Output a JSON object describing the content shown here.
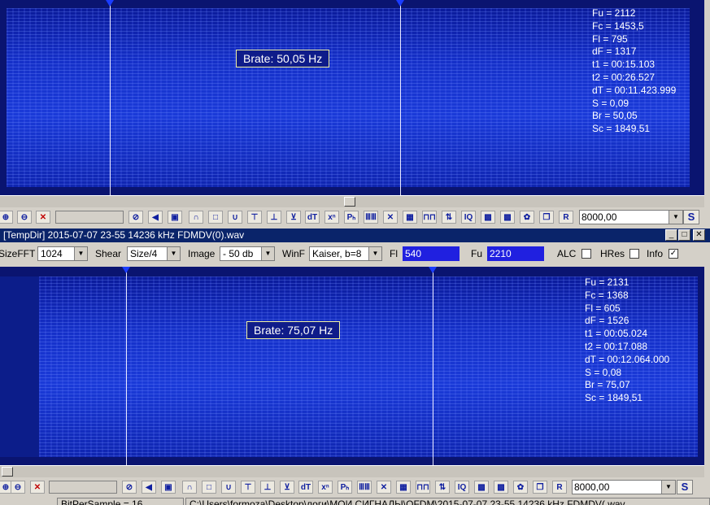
{
  "top_panel": {
    "brate_label": "Brate: 50,05 Hz",
    "info": [
      "Fu = 2112",
      "Fc = 1453,5",
      "Fl = 795",
      "dF = 1317",
      "t1 = 00:15.103",
      "t2 = 00:26.527",
      "dT = 00:11.423.999",
      "S = 0,09",
      "Br = 50,05",
      "Sc = 1849,51"
    ]
  },
  "toolbar_top": {
    "buttons": [
      {
        "name": "zoom-in-icon",
        "glyph": "⊕"
      },
      {
        "name": "zoom-out-icon",
        "glyph": "⊖"
      },
      {
        "name": "close-red-icon",
        "glyph": "✕"
      },
      {
        "name": "stop-icon",
        "glyph": "⊘"
      },
      {
        "name": "speaker-icon",
        "glyph": "◀"
      },
      {
        "name": "record-icon",
        "glyph": "▣"
      },
      {
        "name": "arc-icon",
        "glyph": "∩"
      },
      {
        "name": "rect-icon",
        "glyph": "□"
      },
      {
        "name": "valley-icon",
        "glyph": "∪"
      },
      {
        "name": "tf-icon",
        "glyph": "⊤"
      },
      {
        "name": "tx-icon",
        "glyph": "⊥"
      },
      {
        "name": "antenna-icon",
        "glyph": "⊻"
      },
      {
        "name": "dt-icon",
        "glyph": "dT"
      },
      {
        "name": "xn-icon",
        "glyph": "xⁿ"
      },
      {
        "name": "ph-icon",
        "glyph": "Pₕ"
      },
      {
        "name": "bars-icon",
        "glyph": "ⅢⅢ"
      },
      {
        "name": "cross-icon",
        "glyph": "✕"
      },
      {
        "name": "grid-icon",
        "glyph": "▦"
      },
      {
        "name": "wave-icon",
        "glyph": "⊓⊓"
      },
      {
        "name": "arrows-icon",
        "glyph": "⇅"
      },
      {
        "name": "iq-icon",
        "glyph": "IQ"
      },
      {
        "name": "pattern-a-icon",
        "glyph": "▩"
      },
      {
        "name": "pattern-b-icon",
        "glyph": "▩"
      },
      {
        "name": "gear-icon",
        "glyph": "✿"
      },
      {
        "name": "copy-icon",
        "glyph": "❐"
      },
      {
        "name": "r-icon",
        "glyph": "R"
      }
    ],
    "freq_value": "8000,00",
    "s_label": "S"
  },
  "window": {
    "title": "[TempDir] 2015-07-07 23-55 14236 kHz FDMDV(0).wav",
    "minimize_glyph": "_",
    "maximize_glyph": "□",
    "close_glyph": "✕"
  },
  "settings": {
    "sizefft_label": "SizeFFT",
    "sizefft_value": "1024",
    "shear_label": "Shear",
    "shear_value": "Size/4",
    "image_label": "Image",
    "image_value": "- 50 db",
    "winf_label": "WinF",
    "winf_value": "Kaiser, b=8",
    "fl_label": "Fl",
    "fl_value": "540",
    "fu_label": "Fu",
    "fu_value": "2210",
    "alc_label": "ALC",
    "alc_checked": false,
    "hres_label": "HRes",
    "hres_checked": false,
    "info_label": "Info",
    "info_checked": true,
    "check_glyph": "✓"
  },
  "bottom_panel": {
    "brate_label": "Brate: 75,07 Hz",
    "info": [
      "Fu = 2131",
      "Fc = 1368",
      "Fl = 605",
      "dF = 1526",
      "t1 = 00:05.024",
      "t2 = 00:17.088",
      "dT = 00:12.064.000",
      "S = 0,08",
      "Br = 75,07",
      "Sc = 1849,51"
    ]
  },
  "toolbar_bottom": {
    "freq_value": "8000,00",
    "s_label": "S"
  },
  "status_bar": {
    "bits": "BitPerSample = 16",
    "path": "C:\\Users\\formoza\\Desktop\\логи\\МОИ СИГНАЛЫ\\OFDM\\2015-07-07 23-55 14236 kHz FDMDV(.wav"
  }
}
